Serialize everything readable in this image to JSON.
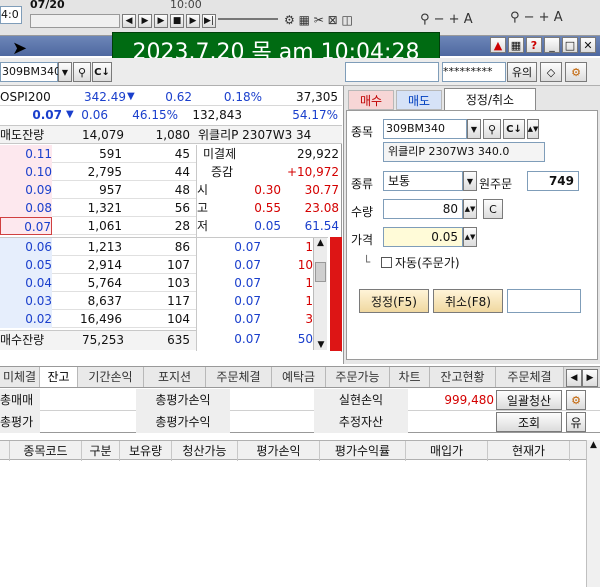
{
  "timestamp": "2023.7.20 목 am 10:04:28",
  "top_bar": {
    "date_fragment": "07/20",
    "time_fragment": "10:00",
    "left_clock": "4:0"
  },
  "search": {
    "code": "309BM340"
  },
  "password_mask": "*********",
  "notice_label": "유의",
  "index_row": {
    "name": "OSPI200",
    "value": "342.49",
    "change": "0.62",
    "pct": "0.18%",
    "volume": "37,305"
  },
  "price_row": {
    "price": "0.07",
    "change": "0.06",
    "pct": "46.15%",
    "volume": "132,843",
    "ratio": "54.17%"
  },
  "order_header": {
    "ask_total_label": "매도잔량",
    "ask_total": "14,079",
    "ask_count": "1,080",
    "product_name": "위클리P 2307W3 34"
  },
  "asks": [
    {
      "price": "0.11",
      "qty": "591",
      "count": "45"
    },
    {
      "price": "0.10",
      "qty": "2,795",
      "count": "44"
    },
    {
      "price": "0.09",
      "qty": "957",
      "count": "48"
    },
    {
      "price": "0.08",
      "qty": "1,321",
      "count": "56"
    },
    {
      "price": "0.07",
      "qty": "1,061",
      "count": "28"
    }
  ],
  "info_panel": [
    {
      "label": "미결제",
      "value1": "29,922",
      "value2": ""
    },
    {
      "label": "증감",
      "value1": "+10,972",
      "value2": ""
    },
    {
      "label": "시",
      "value1": "0.30",
      "value2": "30.77"
    },
    {
      "label": "고",
      "value1": "0.55",
      "value2": "23.08"
    },
    {
      "label": "저",
      "value1": "0.05",
      "value2": "61.54"
    }
  ],
  "bids": [
    {
      "price": "0.06",
      "qty": "1,213",
      "count": "86"
    },
    {
      "price": "0.05",
      "qty": "2,914",
      "count": "107"
    },
    {
      "price": "0.04",
      "qty": "5,764",
      "count": "103"
    },
    {
      "price": "0.03",
      "qty": "8,637",
      "count": "117"
    },
    {
      "price": "0.02",
      "qty": "16,496",
      "count": "104"
    }
  ],
  "trades": [
    {
      "price": "0.07",
      "qty": "1"
    },
    {
      "price": "0.07",
      "qty": "10"
    },
    {
      "price": "0.07",
      "qty": "1"
    },
    {
      "price": "0.07",
      "qty": "1"
    },
    {
      "price": "0.07",
      "qty": "3"
    },
    {
      "price": "0.07",
      "qty": "50"
    }
  ],
  "bid_total": {
    "label": "매수잔량",
    "qty": "75,253",
    "count": "635"
  },
  "order_tabs": [
    "매수",
    "매도",
    "정정/취소"
  ],
  "order_form": {
    "code_label": "종목",
    "code_value": "309BM340",
    "product_name": "위클리P 2307W3 340.0",
    "type_label": "종류",
    "type_value": "보통",
    "original_order_label": "원주문",
    "original_order_value": "749",
    "qty_label": "수량",
    "qty_value": "80",
    "c_button": "C",
    "price_label": "가격",
    "price_value": "0.05",
    "auto_label": "자동(주문가)",
    "modify_button": "정정(F5)",
    "cancel_button": "취소(F8)"
  },
  "bottom_tabs": [
    "미체결",
    "잔고",
    "기간손익",
    "포지션",
    "주문체결",
    "예탁금",
    "주문가능",
    "차트",
    "잔고현황",
    "주문체결"
  ],
  "summary": {
    "row1_left": "총매매",
    "row1_mid": "총평가손익",
    "row1_right_label": "실현손익",
    "row1_right_value": "999,480",
    "row1_button": "일괄청산",
    "row2_left": "총평가",
    "row2_mid": "총평가수익",
    "row2_right_label": "추정자산",
    "row2_button": "조회",
    "row2_extra": "유"
  },
  "columns": [
    "종목코드",
    "구분",
    "보유량",
    "청산가능",
    "평가손익",
    "평가수익률",
    "매입가",
    "현재가"
  ],
  "colors": {
    "green_banner": "#006b12",
    "pink_ask": "#fde8ee",
    "blue_bid": "#e6eefc",
    "tab_active": "#ffffff"
  }
}
